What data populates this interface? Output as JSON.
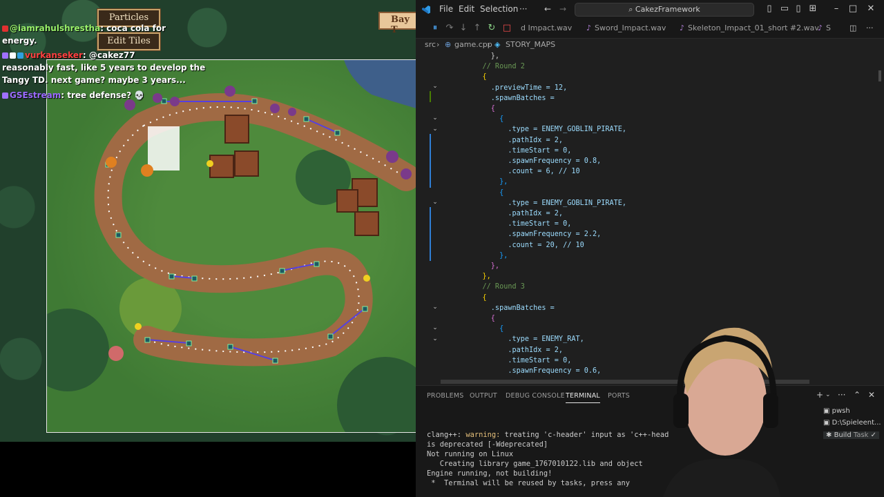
{
  "game": {
    "buttons": {
      "particles": "Particles",
      "edit_tiles": "Edit Tiles"
    },
    "sign_text": "Bay T",
    "chat": [
      {
        "user": "@iamrahulshrestha",
        "user_color": "#9bf36b",
        "message": ": coca cola for"
      },
      {
        "user": "",
        "user_color": "#ffffff",
        "message": "energy."
      },
      {
        "user": "vurkanseker",
        "user_color": "#ff4040",
        "message": ": @cakez77"
      },
      {
        "user": "",
        "user_color": "#ffffff",
        "message": "reasonably fast, like 5 years to develop the"
      },
      {
        "user": "",
        "user_color": "#ffffff",
        "message": "Tangy TD. next game? maybe 3 years..."
      },
      {
        "user": "GSEstream",
        "user_color": "#9b6bff",
        "message": ": tree defense? 💀"
      }
    ]
  },
  "vscode": {
    "menu": [
      "File",
      "Edit",
      "Selection",
      "···"
    ],
    "search_text": "CakezFramework",
    "tabs": [
      {
        "label": "d Impact.wav"
      },
      {
        "label": "Sword_Impact.wav"
      },
      {
        "label": "Skeleton_Impact_01_short #2.wav"
      },
      {
        "label": "S"
      }
    ],
    "breadcrumb": {
      "folder": "src",
      "file": "game.cpp",
      "symbol": "STORY_MAPS"
    },
    "code_lines": [
      {
        "text": "      },",
        "cls": ""
      },
      {
        "text": "    // Round 2",
        "cls": "tk-comment"
      },
      {
        "text": "    {",
        "cls": "tk-brace"
      },
      {
        "text": "      .previewTime = 12,",
        "cls": "tk-field"
      },
      {
        "text": "      .spawnBatches =",
        "cls": "tk-field"
      },
      {
        "text": "      {",
        "cls": "tk-brace2"
      },
      {
        "text": "        {",
        "cls": "tk-brace3"
      },
      {
        "text": "          .type = ENEMY_GOBLIN_PIRATE,",
        "cls": "tk-field"
      },
      {
        "text": "          .pathIdx = 2,",
        "cls": "tk-field"
      },
      {
        "text": "          .timeStart = 0,",
        "cls": "tk-field"
      },
      {
        "text": "          .spawnFrequency = 0.8,",
        "cls": "tk-field"
      },
      {
        "text": "          .count = 6, // 10",
        "cls": "tk-field"
      },
      {
        "text": "        },",
        "cls": "tk-brace3"
      },
      {
        "text": "        {",
        "cls": "tk-brace3"
      },
      {
        "text": "          .type = ENEMY_GOBLIN_PIRATE,",
        "cls": "tk-field"
      },
      {
        "text": "          .pathIdx = 2,",
        "cls": "tk-field"
      },
      {
        "text": "          .timeStart = 0,",
        "cls": "tk-field"
      },
      {
        "text": "          .spawnFrequency = 2.2,",
        "cls": "tk-field"
      },
      {
        "text": "          .count = 20, // 10",
        "cls": "tk-field"
      },
      {
        "text": "        },",
        "cls": "tk-brace3"
      },
      {
        "text": "      },",
        "cls": "tk-brace2"
      },
      {
        "text": "    },",
        "cls": "tk-brace"
      },
      {
        "text": "    // Round 3",
        "cls": "tk-comment"
      },
      {
        "text": "    {",
        "cls": "tk-brace"
      },
      {
        "text": "      .spawnBatches =",
        "cls": "tk-field"
      },
      {
        "text": "      {",
        "cls": "tk-brace2"
      },
      {
        "text": "        {",
        "cls": "tk-brace3"
      },
      {
        "text": "          .type = ENEMY_RAT,",
        "cls": "tk-field"
      },
      {
        "text": "          .pathIdx = 2,",
        "cls": "tk-field"
      },
      {
        "text": "          .timeStart = 0,",
        "cls": "tk-field"
      },
      {
        "text": "          .spawnFrequency = 0.6,",
        "cls": "tk-field"
      }
    ],
    "panel_tabs": [
      "PROBLEMS",
      "OUTPUT",
      "DEBUG CONSOLE",
      "TERMINAL",
      "PORTS"
    ],
    "terminal": [
      {
        "prefix": "clang++: ",
        "warn": "warning:",
        "text": " treating 'c-header' input as 'c++-head"
      },
      {
        "prefix": "",
        "warn": "",
        "text": "is deprecated [-Wdeprecated]"
      },
      {
        "prefix": "",
        "warn": "",
        "text": "Not running on Linux"
      },
      {
        "prefix": "",
        "warn": "",
        "text": "   Creating library game_1767010122.lib and object"
      },
      {
        "prefix": "",
        "warn": "",
        "text": "Engine running, not building!"
      },
      {
        "prefix": "",
        "warn": "",
        "text": " *  Terminal will be reused by tasks, press any"
      }
    ],
    "terminal_list": [
      {
        "label": "pwsh"
      },
      {
        "label": "D:\\Spieleent..."
      },
      {
        "label": "Build",
        "suffix": "Task"
      }
    ]
  }
}
